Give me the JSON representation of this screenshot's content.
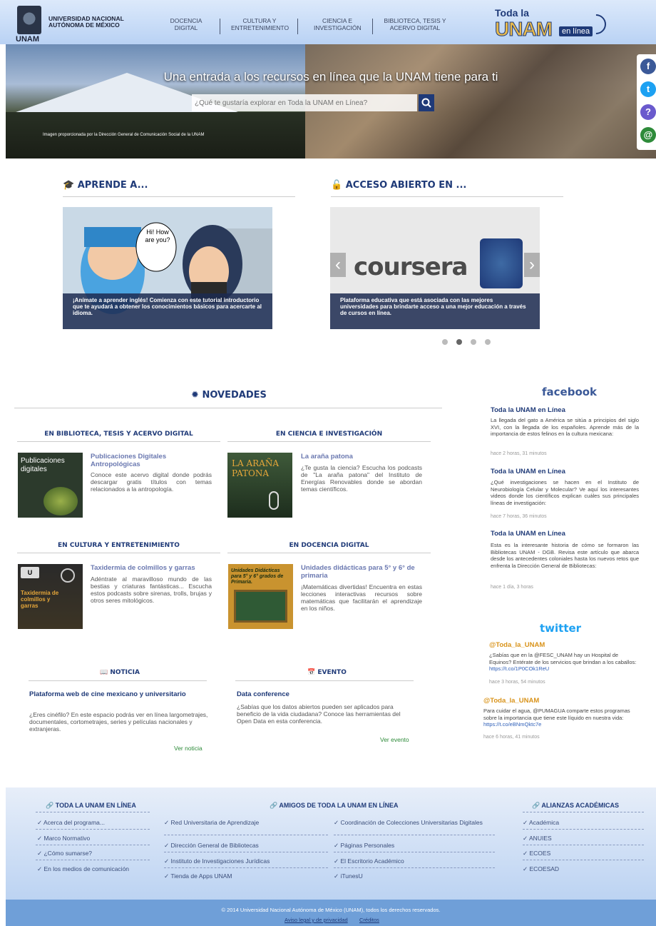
{
  "header": {
    "unam_short": "UNAM",
    "university": "UNIVERSIDAD NACIONAL AUTÓNOMA DE MÉXICO",
    "nav": [
      {
        "label": "DOCENCIA DIGITAL"
      },
      {
        "label": "CULTURA Y ENTRETENIMIENTO"
      },
      {
        "label": "CIENCIA E INVESTIGACIÓN"
      },
      {
        "label": "BIBLIOTECA, TESIS Y ACERVO DIGITAL"
      }
    ],
    "brand": {
      "line1": "Toda la",
      "line2": "UNAM",
      "line3": "en línea"
    }
  },
  "hero": {
    "title": "Una entrada a los recursos en línea que la UNAM tiene para ti",
    "search_placeholder": "¿Qué te gustaría explorar en Toda la UNAM en Línea?",
    "credit": "Imagen proporcionada por la Dirección General de Comunicación Social de la UNAM"
  },
  "social": [
    {
      "icon": "facebook-icon",
      "glyph": "f",
      "color": "#3b5998"
    },
    {
      "icon": "twitter-icon",
      "glyph": "t",
      "color": "#1da1f2"
    },
    {
      "icon": "contact-icon",
      "glyph": "?",
      "color": "#6a5acd"
    },
    {
      "icon": "mail-icon",
      "glyph": "@",
      "color": "#2e8b3a"
    }
  ],
  "aprende": {
    "heading": "APRENDE A...",
    "bubble": "Hi! How are you?",
    "caption": "¡Anímate a aprender inglés! Comienza con este tutorial introductorio que te ayudará a obtener los conocimientos básicos para acercarte al idioma."
  },
  "acceso": {
    "heading": "ACCESO ABIERTO EN ...",
    "logo_text": "coursera",
    "caption": "Plataforma educativa que está asociada con las mejores universidades para brindarte acceso a una mejor educación a través de cursos en línea."
  },
  "novedades": {
    "heading": "NOVEDADES",
    "sections": [
      {
        "category": "EN BIBLIOTECA, TESIS Y ACERVO DIGITAL",
        "thumb_text": "Publicaciones digitales",
        "title": "Publicaciones Digitales Antropológicas",
        "desc": "Conoce este acervo digital donde podrás descargar gratis títulos con temas relacionados a la antropología."
      },
      {
        "category": "EN CIENCIA E INVESTIGACIÓN",
        "thumb_text": "LA ARAÑA PATONA",
        "title": "La araña patona",
        "desc": "¿Te gusta la ciencia? Escucha los podcasts de \"La araña patona\" del Instituto de Energías Renovables donde se abordan temas científicos."
      },
      {
        "category": "EN CULTURA Y ENTRETENIMIENTO",
        "thumb_text": "Taxidermia de colmillos y garras",
        "title": "Taxidermia de colmillos y garras",
        "desc": "Adéntrate al maravilloso mundo de las bestias y criaturas fantásticas... Escucha estos podcasts sobre sirenas, trolls, brujas y otros seres mitológicos."
      },
      {
        "category": "EN DOCENCIA DIGITAL",
        "thumb_text": "Unidades Didácticas para 5° y 6° grados de Primaria.",
        "title": "Unidades didácticas para 5° y 6° de primaria",
        "desc": "¡Matemáticas divertidas! Encuentra en estas lecciones interactivas recursos sobre matemáticas que facilitarán el aprendizaje en los niños."
      }
    ],
    "noticia": {
      "heading": "NOTICIA",
      "title": "Plataforma web de cine mexicano y universitario",
      "desc": "¿Eres cinéfilo? En este espacio podrás ver en línea largometrajes, documentales, cortometrajes, series y películas nacionales y extranjeras.",
      "link": "Ver noticia"
    },
    "evento": {
      "heading": "EVENTO",
      "title": "Data conference",
      "desc": "¿Sabías que los datos abiertos pueden ser aplicados para beneficio de la vida ciudadana? Conoce las herramientas del Open Data en esta conferencia.",
      "link": "Ver evento"
    }
  },
  "facebook": {
    "logo": "facebook",
    "posts": [
      {
        "author": "Toda la UNAM en Línea",
        "text": "La llegada del gato a América se sitúa a principios del siglo XVI, con la llegada de los españoles. Aprende más de la importancia de estos felinos en la cultura mexicana:",
        "time": "hace 2 horas, 31 minutos"
      },
      {
        "author": "Toda la UNAM en Línea",
        "text": "¿Qué investigaciones se hacen en el Instituto de Neurobiología Celular y Molecular? Ve aquí los interesantes videos donde los científicos explican cuáles sus principales líneas de investigación:",
        "time": "hace 7 horas, 36 minutos"
      },
      {
        "author": "Toda la UNAM en Línea",
        "text": "Esta es la interesante historia de cómo se formaron las Bibliotecas UNAM - DGB. Revisa este artículo que abarca desde los antecedentes coloniales hasta los nuevos retos que enfrenta la Dirección General de Bibliotecas:",
        "time": "hace 1 día, 3 horas"
      }
    ]
  },
  "twitter": {
    "logo": "twitter",
    "tweets": [
      {
        "handle": "@Toda_la_UNAM",
        "text": "¿Sabías que en la @FESC_UNAM hay un Hospital de Equinos? Entérate de los servicios que brindan a los caballos:",
        "link": "https://t.co/1P0COk1ReU",
        "time": "hace 3 horas, 54 minutos"
      },
      {
        "handle": "@Toda_la_UNAM",
        "text": "Para cuidar el agua, @PUMAGUA comparte estos programas sobre la importancia que tiene este líquido en nuestra vida:",
        "link": "https://t.co/eBNmQktc7e",
        "time": "hace 6 horas, 41 minutos"
      }
    ]
  },
  "footer": {
    "col1": {
      "heading": "TODA LA UNAM EN LÍNEA",
      "items": [
        "Acerca del programa...",
        "Marco Normativo",
        "¿Cómo sumarse?",
        "En los medios de comunicación"
      ]
    },
    "col2": {
      "heading": "AMIGOS DE TODA LA UNAM EN LÍNEA",
      "left": [
        "Red Universitaria de Aprendizaje",
        "Dirección General de Bibliotecas",
        "Instituto de Investigaciones Jurídicas",
        "Tienda de Apps UNAM"
      ],
      "right": [
        "Coordinación de Colecciones Universitarias Digitales",
        "Páginas Personales",
        "El Escritorio Académico",
        "iTunesU"
      ]
    },
    "col3": {
      "heading": "ALIANZAS ACADÉMICAS",
      "items": [
        "Académica",
        "ANUIES",
        "ECOES",
        "ECOESAD"
      ]
    },
    "copyright": "© 2014 Universidad Nacional Autónoma de México (UNAM), todos los derechos reservados.",
    "privacy": "Aviso legal y de privacidad",
    "credits": "Créditos"
  }
}
